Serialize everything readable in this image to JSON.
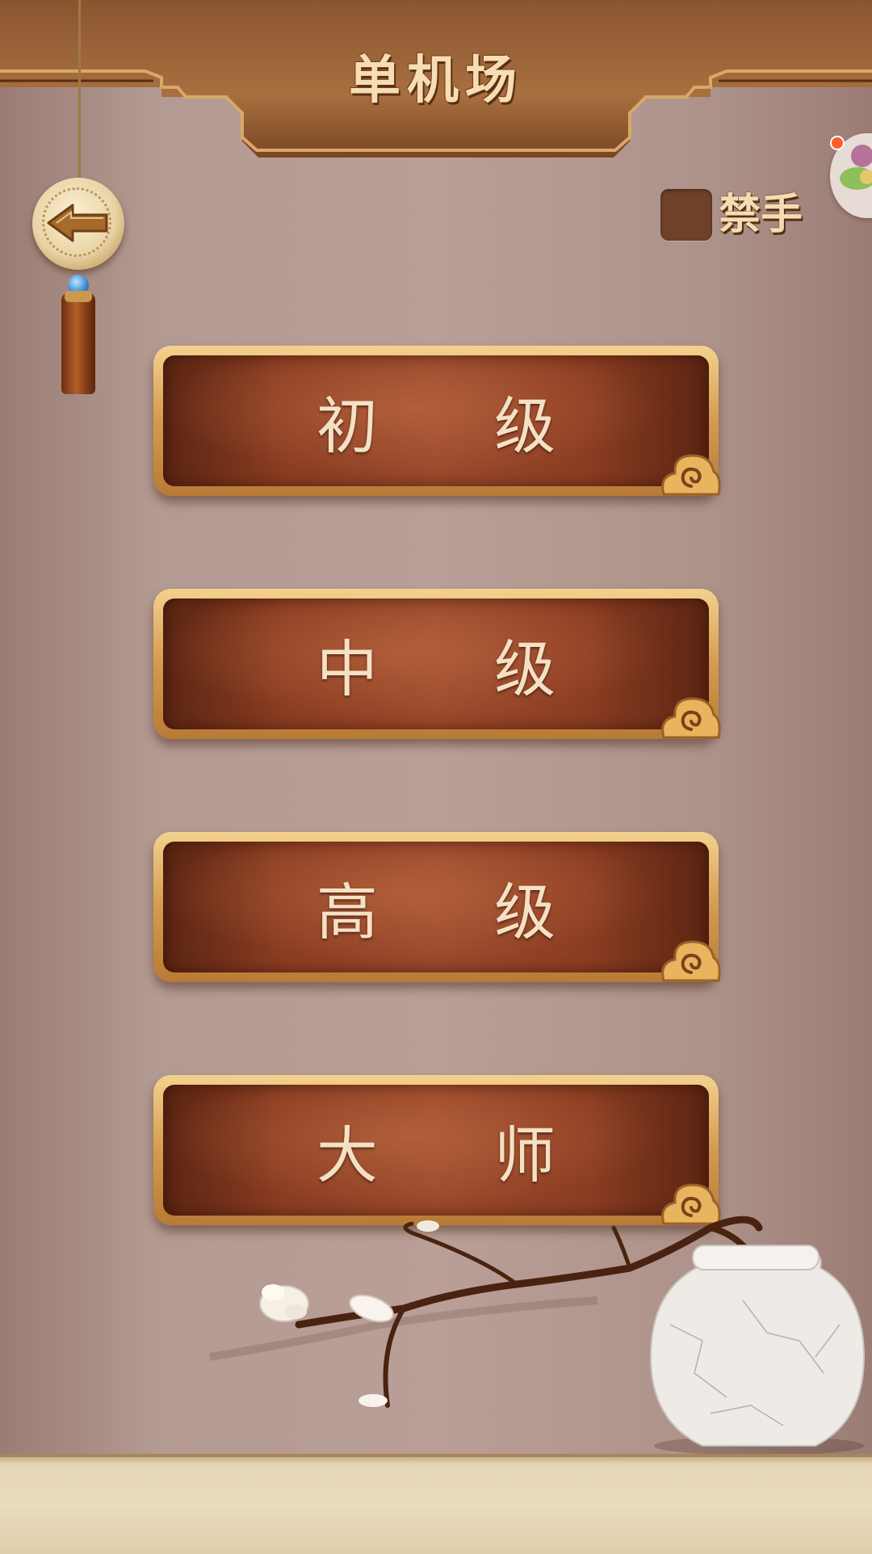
{
  "header": {
    "title": "单机场"
  },
  "back_button": {
    "icon": "left-arrow-icon"
  },
  "forbidden_toggle": {
    "label": "禁手",
    "checked": false
  },
  "levels": [
    {
      "label": "初 级"
    },
    {
      "label": "中 级"
    },
    {
      "label": "高 级"
    },
    {
      "label": "大 师"
    }
  ],
  "colors": {
    "background": "#b39a92",
    "button_face": "#8b3d22",
    "button_border": "#d59a4f",
    "header_wood": "#9a5f34",
    "text_light": "#f4e1c5"
  }
}
